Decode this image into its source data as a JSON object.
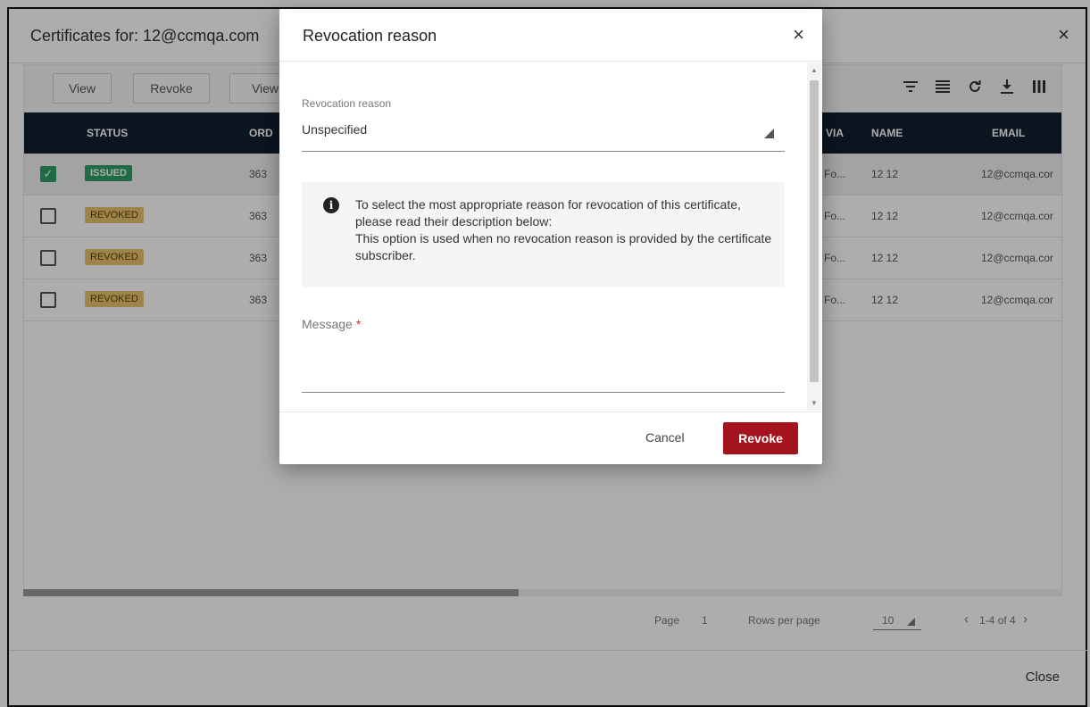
{
  "background_dialog": {
    "title": "Certificates for: 12@ccmqa.com",
    "close_icon": "×",
    "toolbar": {
      "buttons": [
        "View",
        "Revoke",
        "View"
      ],
      "icons": [
        "filter-icon",
        "lines-icon",
        "refresh-icon",
        "download-icon",
        "columns-icon"
      ]
    },
    "table": {
      "headers": {
        "status": "STATUS",
        "order": "ORD",
        "via": "VIA",
        "name": "NAME",
        "email": "EMAIL"
      },
      "rows": [
        {
          "checked": true,
          "status": "ISSUED",
          "order": "363",
          "via": "Fo...",
          "name": "12 12",
          "email": "12@ccmqa.cor"
        },
        {
          "checked": false,
          "status": "REVOKED",
          "order": "363",
          "via": "Fo...",
          "name": "12 12",
          "email": "12@ccmqa.cor"
        },
        {
          "checked": false,
          "status": "REVOKED",
          "order": "363",
          "via": "Fo...",
          "name": "12 12",
          "email": "12@ccmqa.cor"
        },
        {
          "checked": false,
          "status": "REVOKED",
          "order": "363",
          "via": "Fo...",
          "name": "12 12",
          "email": "12@ccmqa.cor"
        }
      ]
    },
    "pagination": {
      "page_label": "Page",
      "page_value": "1",
      "rows_label": "Rows per page",
      "rows_value": "10",
      "range": "1-4 of 4"
    },
    "close_label": "Close"
  },
  "modal": {
    "title": "Revocation reason",
    "close_icon": "×",
    "reason": {
      "label": "Revocation reason",
      "value": "Unspecified"
    },
    "info": {
      "icon": "i",
      "line1": "To select the most appropriate reason for revocation of this certificate, please read their description below:",
      "line2": "This option is used when no revocation reason is provided by the certificate subscriber."
    },
    "message": {
      "label": "Message",
      "required_mark": "*"
    },
    "cancel_label": "Cancel",
    "revoke_label": "Revoke"
  },
  "colors": {
    "header_bg": "#10202e",
    "issued": "#2e9e67",
    "revoked": "#e7c36a",
    "primary_button": "#a3141e",
    "required": "#d32f2f"
  }
}
